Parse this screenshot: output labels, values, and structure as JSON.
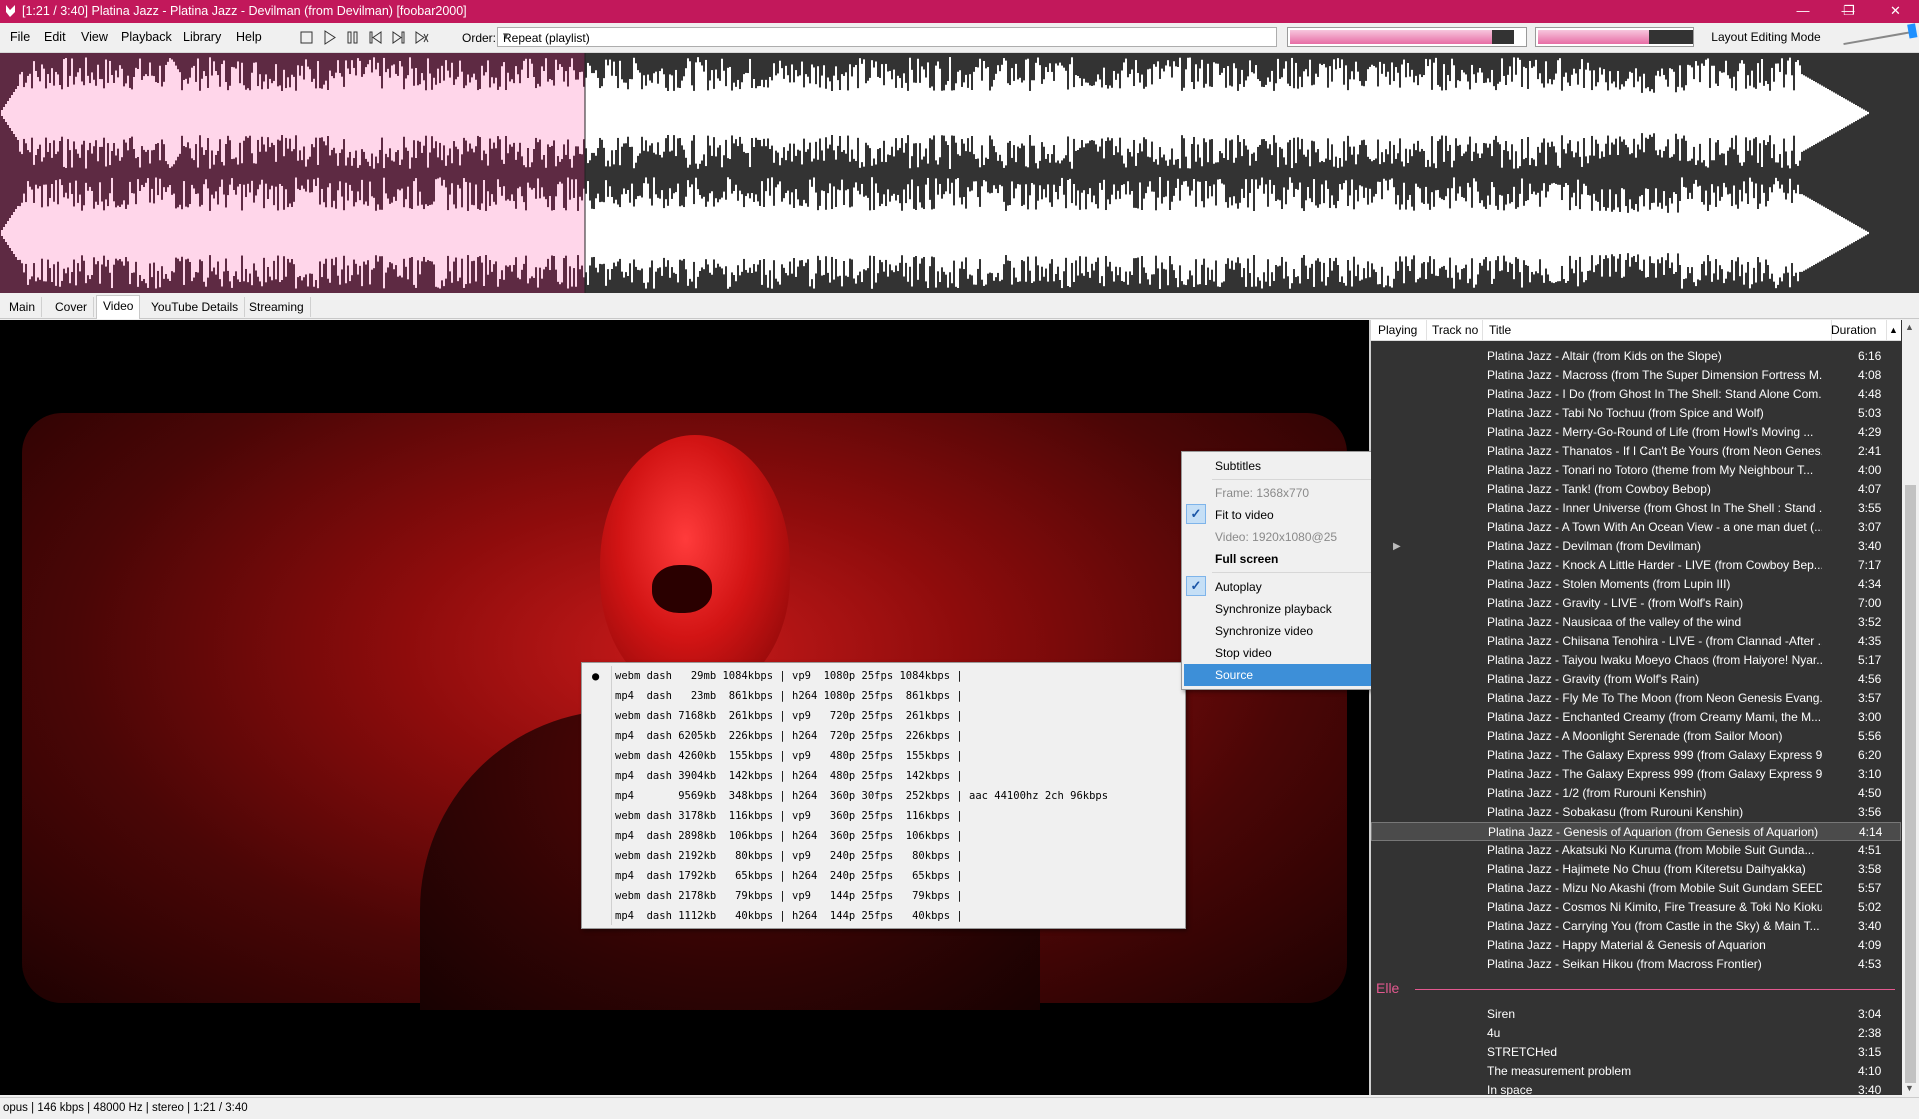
{
  "window": {
    "title": "[1:21 / 3:40] Platina Jazz - Platina Jazz - Devilman (from Devilman)  [foobar2000]",
    "controls": [
      "—",
      "❐",
      "✕"
    ]
  },
  "menu": [
    "File",
    "Edit",
    "View",
    "Playback",
    "Library",
    "Help"
  ],
  "toolbar": {
    "order_label": "Order:",
    "order_value": "Repeat (playlist)",
    "layout_button": "Layout Editing Mode",
    "seek_position_fraction": 0.37,
    "volume_fraction": 0.72
  },
  "tabs": [
    {
      "label": "Main"
    },
    {
      "label": "Cover"
    },
    {
      "label": "Video"
    },
    {
      "label": "YouTube Details"
    },
    {
      "label": "Streaming"
    }
  ],
  "context_menu": {
    "subtitles": "Subtitles",
    "frame": "Frame: 1368x770",
    "fit_to_video": "Fit to video",
    "video_info": "Video: 1920x1080@25",
    "full_screen": "Full screen",
    "autoplay": "Autoplay",
    "sync_playback": "Synchronize playback",
    "sync_video": "Synchronize video",
    "stop_video": "Stop video",
    "source": "Source"
  },
  "source_list": [
    "webm dash   29mb 1084kbps | vp9  1080p 25fps 1084kbps |",
    "mp4  dash   23mb  861kbps | h264 1080p 25fps  861kbps |",
    "webm dash 7168kb  261kbps | vp9   720p 25fps  261kbps |",
    "mp4  dash 6205kb  226kbps | h264  720p 25fps  226kbps |",
    "webm dash 4260kb  155kbps | vp9   480p 25fps  155kbps |",
    "mp4  dash 3904kb  142kbps | h264  480p 25fps  142kbps |",
    "mp4       9569kb  348kbps | h264  360p 30fps  252kbps | aac 44100hz 2ch 96kbps",
    "webm dash 3178kb  116kbps | vp9   360p 25fps  116kbps |",
    "mp4  dash 2898kb  106kbps | h264  360p 25fps  106kbps |",
    "webm dash 2192kb   80kbps | vp9   240p 25fps   80kbps |",
    "mp4  dash 1792kb   65kbps | h264  240p 25fps   65kbps |",
    "webm dash 2178kb   79kbps | vp9   144p 25fps   79kbps |",
    "mp4  dash 1112kb   40kbps | h264  144p 25fps   40kbps |"
  ],
  "playlist": {
    "columns": [
      "Playing",
      "Track no",
      "Title",
      "Duration"
    ],
    "tracks": [
      {
        "title": "Platina Jazz - Altair (from Kids on the Slope)",
        "duration": "6:16"
      },
      {
        "title": "Platina Jazz - Macross (from The Super Dimension Fortress M...",
        "duration": "4:08"
      },
      {
        "title": "Platina Jazz - I Do (from Ghost In The Shell: Stand Alone Com...",
        "duration": "4:48"
      },
      {
        "title": "Platina Jazz - Tabi No Tochuu (from Spice and Wolf)",
        "duration": "5:03"
      },
      {
        "title": "Platina Jazz - Merry-Go-Round of Life (from Howl's Moving ...",
        "duration": "4:29"
      },
      {
        "title": "Platina Jazz - Thanatos - If I Can't Be Yours (from Neon Genes...",
        "duration": "2:41"
      },
      {
        "title": "Platina Jazz - Tonari no Totoro (theme from My Neighbour T...",
        "duration": "4:00"
      },
      {
        "title": "Platina Jazz - Tank! (from Cowboy Bebop)",
        "duration": "4:07"
      },
      {
        "title": "Platina Jazz - Inner Universe (from Ghost In The Shell : Stand ...",
        "duration": "3:55"
      },
      {
        "title": "Platina Jazz - A Town With An Ocean View - a one man duet (...",
        "duration": "3:07"
      },
      {
        "title": "Platina Jazz - Devilman (from Devilman)",
        "duration": "3:40"
      },
      {
        "title": "Platina Jazz - Knock A Little Harder - LIVE (from Cowboy Bep...",
        "duration": "7:17"
      },
      {
        "title": "Platina Jazz - Stolen Moments (from Lupin III)",
        "duration": "4:34"
      },
      {
        "title": "Platina Jazz - Gravity - LIVE - (from Wolf's Rain)",
        "duration": "7:00"
      },
      {
        "title": "Platina Jazz - Nausicaa of the valley of the wind",
        "duration": "3:52"
      },
      {
        "title": "Platina Jazz - Chiisana Tenohira - LIVE - (from Clannad -After ...",
        "duration": "4:35"
      },
      {
        "title": "Platina Jazz - Taiyou Iwaku Moeyo Chaos (from Haiyore! Nyar...",
        "duration": "5:17"
      },
      {
        "title": "Platina Jazz - Gravity (from Wolf's Rain)",
        "duration": "4:56"
      },
      {
        "title": "Platina Jazz - Fly Me To The Moon (from Neon Genesis Evang...",
        "duration": "3:57"
      },
      {
        "title": "Platina Jazz - Enchanted Creamy (from Creamy Mami, the M...",
        "duration": "3:00"
      },
      {
        "title": "Platina Jazz - A Moonlight Serenade (from Sailor Moon)",
        "duration": "5:56"
      },
      {
        "title": "Platina Jazz - The Galaxy Express 999 (from Galaxy Express 999)",
        "duration": "6:20"
      },
      {
        "title": "Platina Jazz - The Galaxy Express 999 (from Galaxy Express 999)",
        "duration": "3:10"
      },
      {
        "title": "Platina Jazz - 1/2 (from Rurouni Kenshin)",
        "duration": "4:50"
      },
      {
        "title": "Platina Jazz - Sobakasu (from Rurouni Kenshin)",
        "duration": "3:56"
      },
      {
        "title": "Platina Jazz - Genesis of Aquarion (from Genesis of Aquarion)",
        "duration": "4:14"
      },
      {
        "title": "Platina Jazz - Akatsuki No Kuruma (from Mobile Suit Gunda...",
        "duration": "4:51"
      },
      {
        "title": "Platina Jazz - Hajimete No Chuu (from Kiteretsu Daihyakka)",
        "duration": "3:58"
      },
      {
        "title": "Platina Jazz - Mizu No Akashi (from Mobile Suit Gundam SEED)",
        "duration": "5:57"
      },
      {
        "title": "Platina Jazz - Cosmos Ni Kimito, Fire Treasure & Toki No Kioku",
        "duration": "5:02"
      },
      {
        "title": "Platina Jazz - Carrying You (from Castle in the Sky) & Main T...",
        "duration": "3:40"
      },
      {
        "title": "Platina Jazz - Happy Material & Genesis of Aquarion",
        "duration": "4:09"
      },
      {
        "title": "Platina Jazz - Seikan Hikou (from Macross Frontier)",
        "duration": "4:53"
      }
    ],
    "group": "Elle",
    "group_tracks": [
      {
        "title": "Siren",
        "duration": "3:04"
      },
      {
        "title": "4u",
        "duration": "2:38"
      },
      {
        "title": "STRETCHed",
        "duration": "3:15"
      },
      {
        "title": "The measurement problem",
        "duration": "4:10"
      },
      {
        "title": "In space",
        "duration": "3:40"
      }
    ],
    "playing_index": 10,
    "selected_index": 25
  },
  "status": "opus | 146 kbps | 48000 Hz | stereo | 1:21 / 3:40",
  "colors": {
    "accent": "#c2185b",
    "waveform_played": "#ffd6ea",
    "waveform_bg_played": "#5e2a43",
    "group": "#e2598f"
  }
}
